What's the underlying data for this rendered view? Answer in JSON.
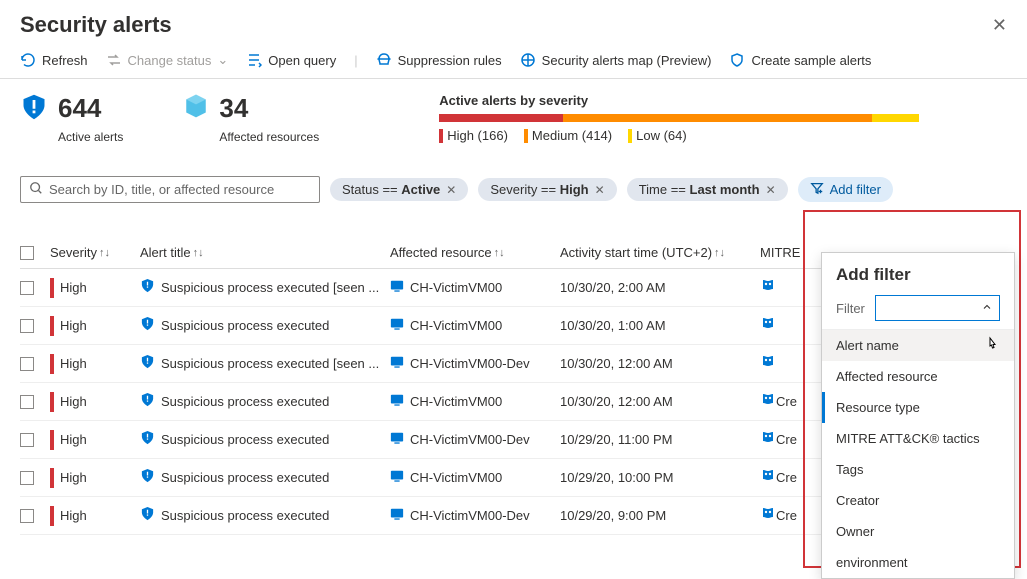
{
  "page_title": "Security alerts",
  "toolbar": {
    "refresh": "Refresh",
    "change_status": "Change status",
    "open_query": "Open query",
    "suppression": "Suppression rules",
    "map": "Security alerts map (Preview)",
    "sample": "Create sample alerts"
  },
  "stats": {
    "active_count": "644",
    "active_label": "Active alerts",
    "affected_count": "34",
    "affected_label": "Affected resources"
  },
  "severity": {
    "title": "Active alerts by severity",
    "high": "High (166)",
    "medium": "Medium (414)",
    "low": "Low (64)"
  },
  "search_placeholder": "Search by ID, title, or affected resource",
  "pills": {
    "status_pre": "Status == ",
    "status_val": "Active",
    "severity_pre": "Severity == ",
    "severity_val": "High",
    "time_pre": "Time == ",
    "time_val": "Last month",
    "add": "Add filter"
  },
  "columns": {
    "severity": "Severity",
    "title": "Alert title",
    "resource": "Affected resource",
    "time": "Activity start time (UTC+2)",
    "mitre": "MITRE"
  },
  "rows": [
    {
      "sev": "High",
      "title": "Suspicious process executed [seen ...",
      "res": "CH-VictimVM00",
      "time": "10/30/20, 2:00 AM",
      "mitre": ""
    },
    {
      "sev": "High",
      "title": "Suspicious process executed",
      "res": "CH-VictimVM00",
      "time": "10/30/20, 1:00 AM",
      "mitre": ""
    },
    {
      "sev": "High",
      "title": "Suspicious process executed [seen ...",
      "res": "CH-VictimVM00-Dev",
      "time": "10/30/20, 12:00 AM",
      "mitre": ""
    },
    {
      "sev": "High",
      "title": "Suspicious process executed",
      "res": "CH-VictimVM00",
      "time": "10/30/20, 12:00 AM",
      "mitre": "Cre"
    },
    {
      "sev": "High",
      "title": "Suspicious process executed",
      "res": "CH-VictimVM00-Dev",
      "time": "10/29/20, 11:00 PM",
      "mitre": "Cre"
    },
    {
      "sev": "High",
      "title": "Suspicious process executed",
      "res": "CH-VictimVM00",
      "time": "10/29/20, 10:00 PM",
      "mitre": "Cre"
    },
    {
      "sev": "High",
      "title": "Suspicious process executed",
      "res": "CH-VictimVM00-Dev",
      "time": "10/29/20, 9:00 PM",
      "mitre": "Cre"
    }
  ],
  "popup": {
    "title": "Add filter",
    "filter_label": "Filter",
    "options": {
      "alert_name": "Alert name",
      "affected_resource": "Affected resource",
      "resource_type": "Resource type",
      "mitre": "MITRE ATT&CK® tactics",
      "tags": "Tags",
      "creator": "Creator",
      "owner": "Owner",
      "environment": "environment"
    }
  }
}
